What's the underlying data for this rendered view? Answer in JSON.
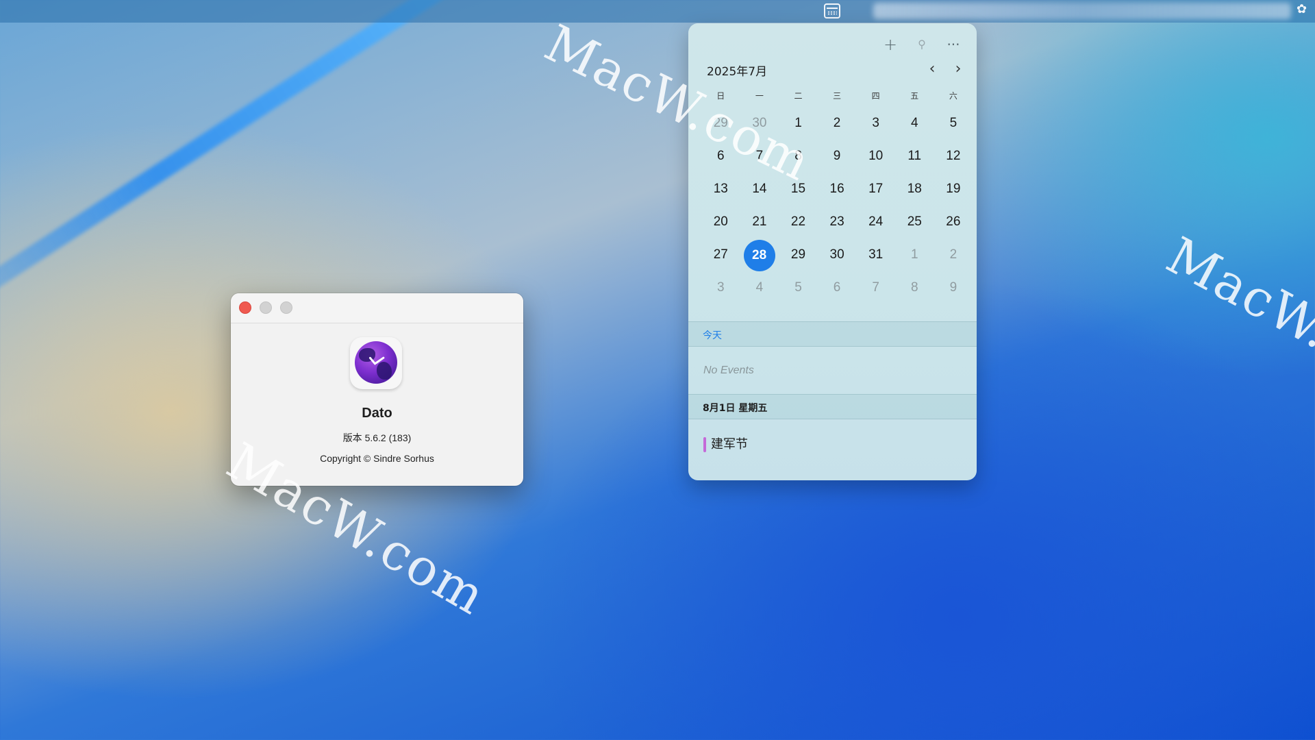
{
  "watermark": {
    "text1": "MacW.com",
    "text2": "MacW.com",
    "text3": "MacW.c"
  },
  "about": {
    "app_name": "Dato",
    "version": "版本 5.6.2 (183)",
    "copyright": "Copyright © Sindre Sorhus"
  },
  "calendar": {
    "month_title": "2025年7月",
    "prev_symbol": "‹",
    "next_symbol": "›",
    "add_symbol": "+",
    "pin_symbol": "⚲",
    "more_symbol": "···",
    "weekdays": [
      "日",
      "一",
      "二",
      "三",
      "四",
      "五",
      "六"
    ],
    "days": [
      {
        "d": "29",
        "muted": true
      },
      {
        "d": "30",
        "muted": true
      },
      {
        "d": "1"
      },
      {
        "d": "2"
      },
      {
        "d": "3"
      },
      {
        "d": "4"
      },
      {
        "d": "5"
      },
      {
        "d": "6"
      },
      {
        "d": "7"
      },
      {
        "d": "8"
      },
      {
        "d": "9"
      },
      {
        "d": "10"
      },
      {
        "d": "11"
      },
      {
        "d": "12"
      },
      {
        "d": "13"
      },
      {
        "d": "14"
      },
      {
        "d": "15"
      },
      {
        "d": "16"
      },
      {
        "d": "17"
      },
      {
        "d": "18"
      },
      {
        "d": "19"
      },
      {
        "d": "20"
      },
      {
        "d": "21"
      },
      {
        "d": "22"
      },
      {
        "d": "23"
      },
      {
        "d": "24"
      },
      {
        "d": "25"
      },
      {
        "d": "26"
      },
      {
        "d": "27"
      },
      {
        "d": "28",
        "today": true
      },
      {
        "d": "29"
      },
      {
        "d": "30"
      },
      {
        "d": "31"
      },
      {
        "d": "1",
        "muted": true
      },
      {
        "d": "2",
        "muted": true
      },
      {
        "d": "3",
        "muted": true
      },
      {
        "d": "4",
        "muted": true
      },
      {
        "d": "5",
        "muted": true
      },
      {
        "d": "6",
        "muted": true
      },
      {
        "d": "7",
        "muted": true
      },
      {
        "d": "8",
        "muted": true
      },
      {
        "d": "9",
        "muted": true
      }
    ],
    "today_label": "今天",
    "no_events": "No Events",
    "next_day_label": "8月1日 星期五",
    "event_title": "建军节",
    "accent_color": "#1f7ee8",
    "event_color": "#c46ad8"
  }
}
